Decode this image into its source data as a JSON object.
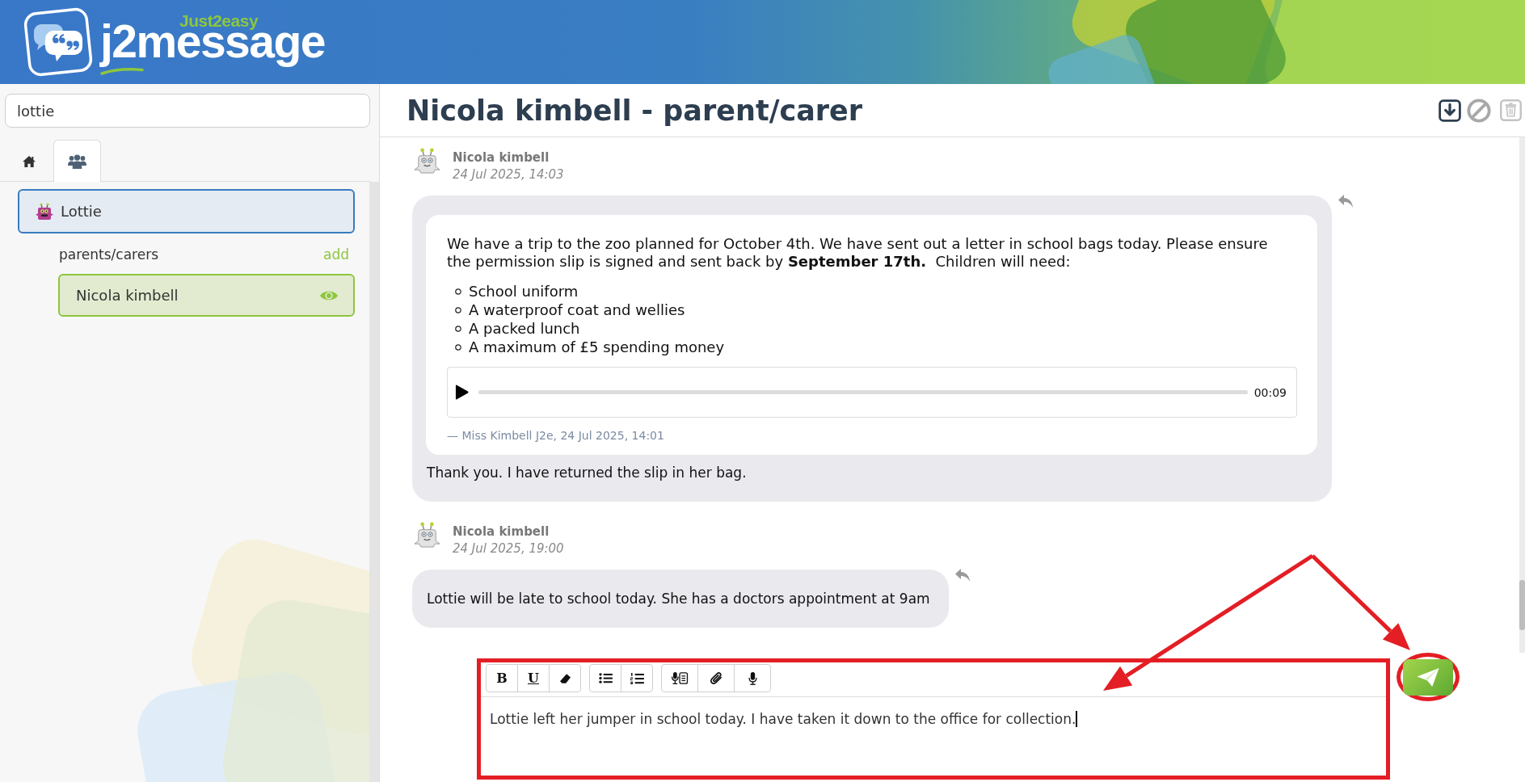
{
  "header": {
    "brand_tagline": "Just2easy",
    "brand_name": "j2message"
  },
  "sidebar": {
    "search": {
      "value": "lottie"
    },
    "tabs": [
      {
        "kind": "home",
        "selected": false
      },
      {
        "kind": "groups",
        "selected": true
      }
    ],
    "pupils": [
      {
        "name": "Lottie",
        "selected": true,
        "groups": [
          {
            "label": "parents/carers",
            "action": "add",
            "members": [
              {
                "name": "Nicola kimbell",
                "selected": true
              }
            ]
          }
        ]
      }
    ]
  },
  "conversation": {
    "title": "Nicola kimbell - parent/carer",
    "actions": [
      {
        "kind": "download",
        "disabled": false
      },
      {
        "kind": "block",
        "disabled": false
      },
      {
        "kind": "delete",
        "disabled": true
      }
    ],
    "messages": [
      {
        "sender": "Nicola kimbell",
        "time": "24 Jul 2025, 14:03",
        "quote": {
          "text": "We have a trip to the zoo planned for October 4th. We have sent out a letter in school bags today. Please ensure the permission slip is signed and sent back by **September 17th.**  Children will need:",
          "items": [
            "School uniform",
            "A waterproof coat and wellies",
            "A packed lunch",
            "A maximum of £5 spending money"
          ],
          "audio": {
            "duration": "00:09"
          },
          "attribution": "— Miss Kimbell J2e, 24 Jul 2025, 14:01"
        },
        "text": "Thank you. I have returned the slip in her bag."
      },
      {
        "sender": "Nicola kimbell",
        "time": "24 Jul 2025, 19:00",
        "text": "Lottie will be late to school today. She has a doctors appointment at 9am"
      }
    ]
  },
  "composer": {
    "toolbar": [
      {
        "buttons": [
          {
            "kind": "bold",
            "label": "B"
          },
          {
            "kind": "underline",
            "label": "U"
          },
          {
            "kind": "clear-format"
          }
        ]
      },
      {
        "buttons": [
          {
            "kind": "bullet-list"
          },
          {
            "kind": "numbered-list"
          }
        ]
      },
      {
        "buttons": [
          {
            "kind": "dictate"
          },
          {
            "kind": "attach"
          },
          {
            "kind": "record"
          }
        ]
      }
    ],
    "value": "Lottie left her jumper in school today. I have taken it down to the office for collection."
  }
}
